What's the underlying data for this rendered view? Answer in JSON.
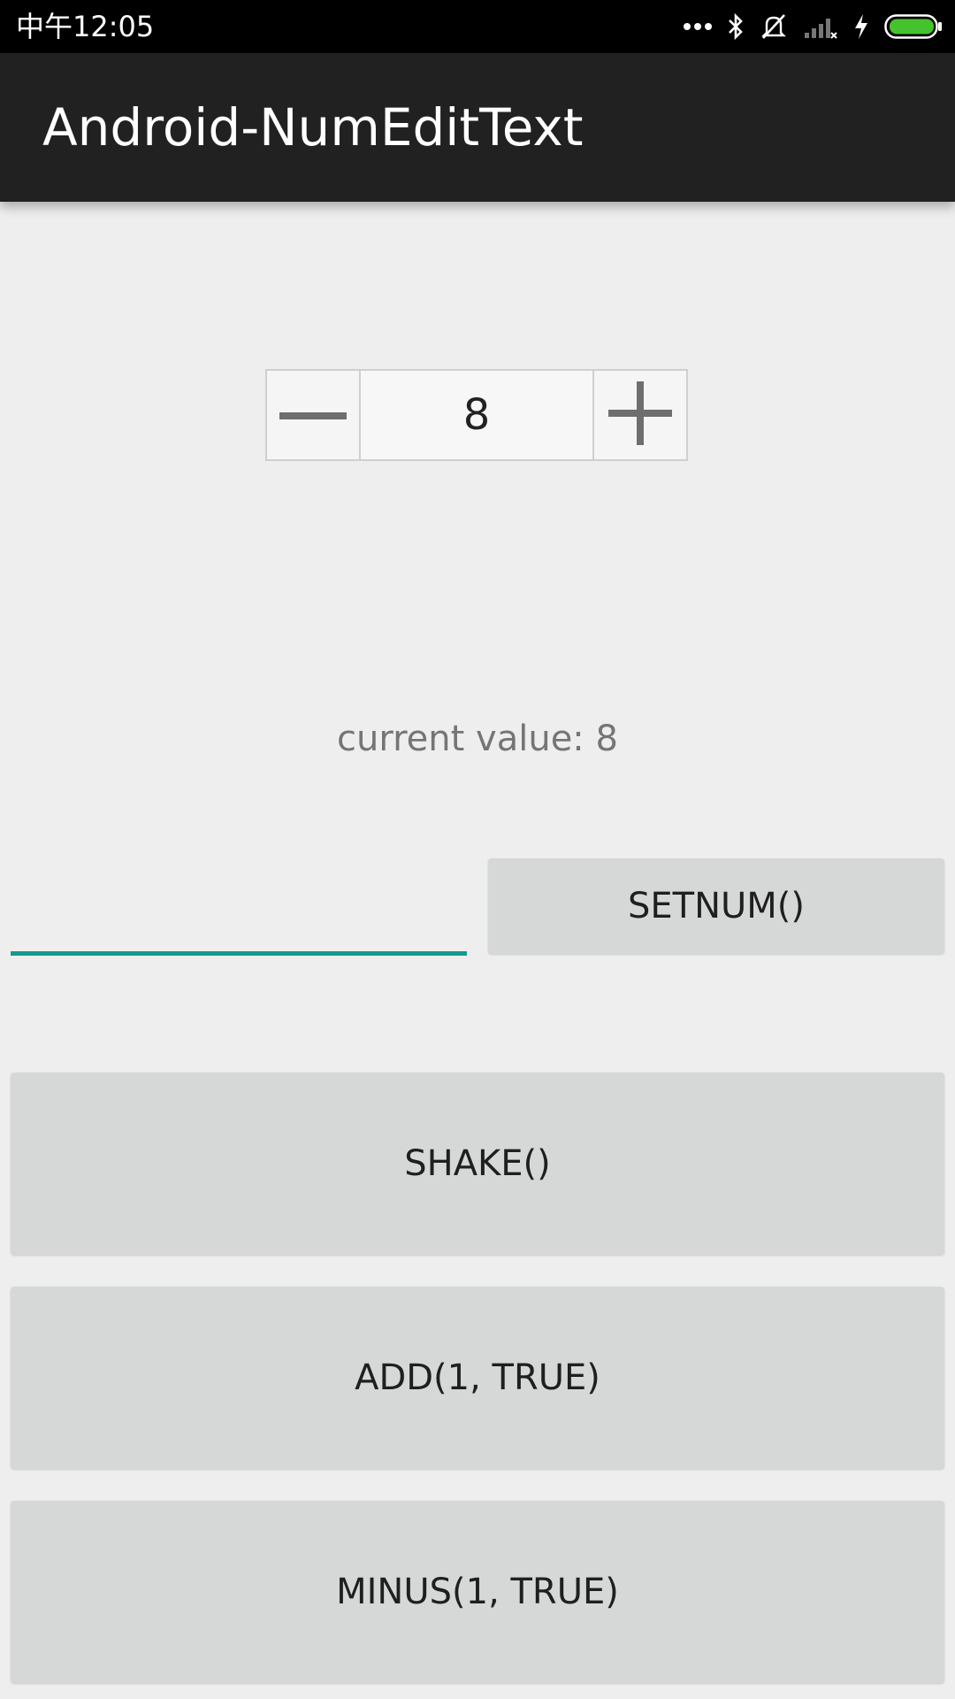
{
  "status_bar": {
    "time": "中午12:05",
    "icons": [
      "more-dots-icon",
      "bluetooth-icon",
      "ringer-off-icon",
      "signal-icon",
      "charging-icon",
      "battery-icon"
    ],
    "battery_color": "#46c22e"
  },
  "app_bar": {
    "title": "Android-NumEditText",
    "background": "#212121"
  },
  "num_edit": {
    "minus_icon": "minus-icon",
    "plus_icon": "plus-icon",
    "value": "8"
  },
  "current_value_label": "current value: 8",
  "set_input": {
    "value": "",
    "placeholder": "",
    "underline_color": "#129a8e"
  },
  "buttons": {
    "setnum": "SETNUM()",
    "shake": "SHAKE()",
    "add": "ADD(1, TRUE)",
    "minus": "MINUS(1, TRUE)"
  }
}
